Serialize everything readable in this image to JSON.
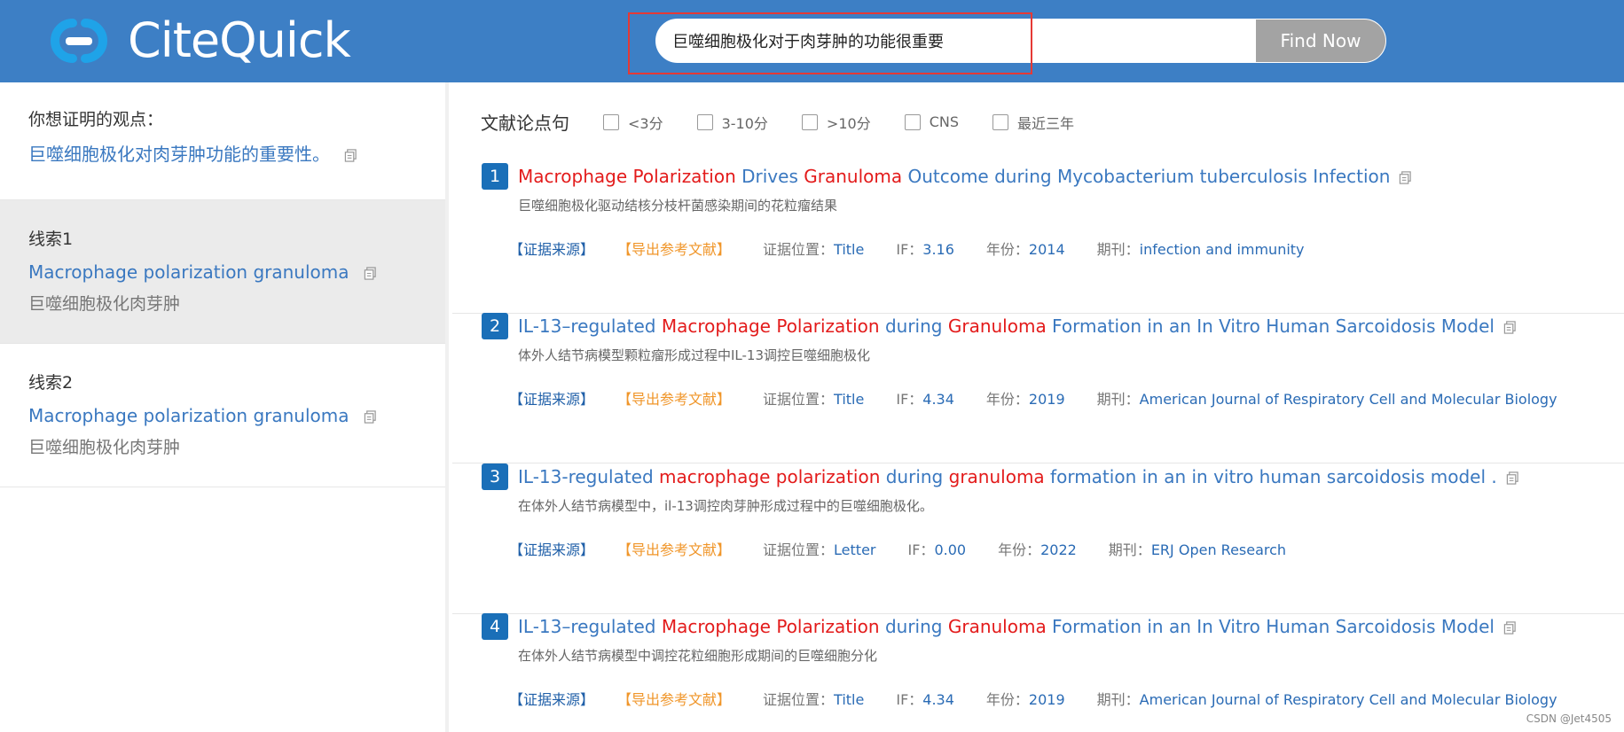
{
  "header": {
    "logo_text": "CiteQuick",
    "search_value": "巨噬细胞极化对于肉芽肿的功能很重要",
    "search_button": "Find Now",
    "brand_color": "#3d7fc5"
  },
  "sidebar": {
    "claim_label": "你想证明的观点：",
    "claim_text": "巨噬细胞极化对肉芽肿功能的重要性。",
    "clues": [
      {
        "title": "线索1",
        "en": "Macrophage polarization granuloma",
        "zh": "巨噬细胞极化肉芽肿"
      },
      {
        "title": "线索2",
        "en": "Macrophage polarization granuloma",
        "zh": "巨噬细胞极化肉芽肿"
      }
    ]
  },
  "filters": {
    "title": "文献论点句",
    "options": [
      "<3分",
      "3-10分",
      ">10分",
      "CNS",
      "最近三年"
    ]
  },
  "meta_labels": {
    "source": "【证据来源】",
    "export": "【导出参考文献】",
    "position": "证据位置：",
    "if": "IF：",
    "year": "年份：",
    "journal": "期刊："
  },
  "results": [
    {
      "num": "1",
      "title_parts": [
        {
          "t": "Macrophage Polarization",
          "hl": true
        },
        {
          "t": " Drives ",
          "hl": false
        },
        {
          "t": "Granuloma",
          "hl": true
        },
        {
          "t": " Outcome during Mycobacterium tuberculosis Infection",
          "hl": false
        }
      ],
      "zh": "巨噬细胞极化驱动结核分枝杆菌感染期间的花粒瘤结果",
      "position": "Title",
      "if": "3.16",
      "year": "2014",
      "journal": "infection and immunity"
    },
    {
      "num": "2",
      "title_parts": [
        {
          "t": "IL-13–regulated ",
          "hl": false
        },
        {
          "t": "Macrophage Polarization",
          "hl": true
        },
        {
          "t": " during ",
          "hl": false
        },
        {
          "t": "Granuloma",
          "hl": true
        },
        {
          "t": " Formation in an In Vitro Human Sarcoidosis Model",
          "hl": false
        }
      ],
      "zh": "体外人结节病模型颗粒瘤形成过程中IL-13调控巨噬细胞极化",
      "position": "Title",
      "if": "4.34",
      "year": "2019",
      "journal": "American Journal of Respiratory Cell and Molecular Biology"
    },
    {
      "num": "3",
      "title_parts": [
        {
          "t": "IL-13-regulated ",
          "hl": false
        },
        {
          "t": "macrophage polarization",
          "hl": true
        },
        {
          "t": " during ",
          "hl": false
        },
        {
          "t": "granuloma",
          "hl": true
        },
        {
          "t": " formation in an in vitro human sarcoidosis model .",
          "hl": false
        }
      ],
      "zh": "在体外人结节病模型中，il-13调控肉芽肿形成过程中的巨噬细胞极化。",
      "position": "Letter",
      "if": "0.00",
      "year": "2022",
      "journal": "ERJ Open Research"
    },
    {
      "num": "4",
      "title_parts": [
        {
          "t": "IL-13–regulated ",
          "hl": false
        },
        {
          "t": "Macrophage Polarization",
          "hl": true
        },
        {
          "t": " during ",
          "hl": false
        },
        {
          "t": "Granuloma",
          "hl": true
        },
        {
          "t": " Formation in an In Vitro Human Sarcoidosis Model",
          "hl": false
        }
      ],
      "zh": "在体外人结节病模型中调控花粒细胞形成期间的巨噬细胞分化",
      "position": "Title",
      "if": "4.34",
      "year": "2019",
      "journal": "American Journal of Respiratory Cell and Molecular Biology"
    }
  ],
  "watermark": "CSDN @Jet4505"
}
